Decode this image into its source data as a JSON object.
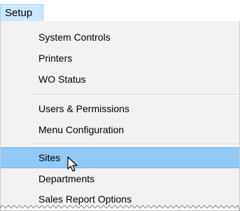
{
  "menubar": {
    "setup_label": "Setup"
  },
  "menu": {
    "items": [
      {
        "label": "System Controls"
      },
      {
        "label": "Printers"
      },
      {
        "label": "WO Status"
      },
      {
        "label": "Users & Permissions"
      },
      {
        "label": "Menu Configuration"
      },
      {
        "label": "Sites"
      },
      {
        "label": "Departments"
      },
      {
        "label": "Sales Report Options"
      }
    ],
    "highlighted_item": "Sites"
  },
  "colors": {
    "menubar_selected_bg": "#cce8ff",
    "menu_bg": "#f2f2f2",
    "highlight_bg": "#91c9f7"
  },
  "cursor_icon": "mouse-pointer-icon"
}
